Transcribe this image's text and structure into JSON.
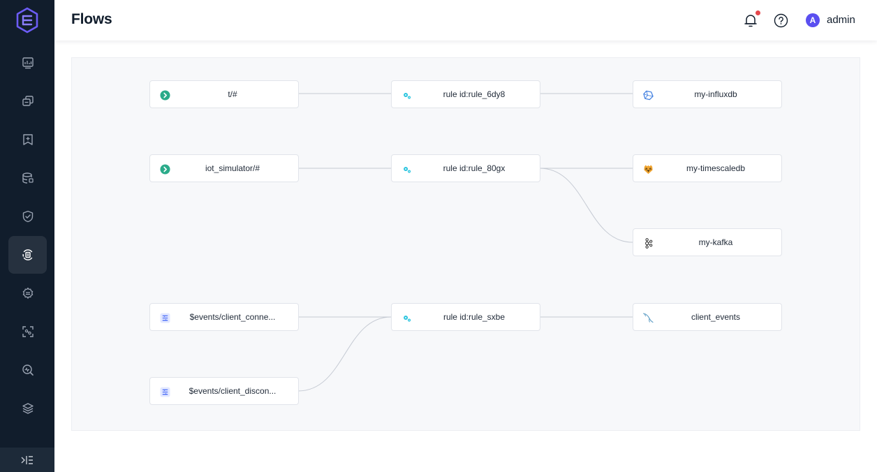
{
  "header": {
    "title": "Flows",
    "avatar_initial": "A",
    "username": "admin"
  },
  "sidebar": {
    "items": [
      {
        "icon": "dashboard-icon"
      },
      {
        "icon": "connections-icon"
      },
      {
        "icon": "subscriptions-icon"
      },
      {
        "icon": "retained-icon"
      },
      {
        "icon": "security-icon"
      },
      {
        "icon": "integration-icon",
        "active": true
      },
      {
        "icon": "settings-icon"
      },
      {
        "icon": "diagnose-icon"
      },
      {
        "icon": "monitor-icon"
      },
      {
        "icon": "plugins-icon"
      }
    ]
  },
  "flows": {
    "sources": [
      {
        "label": "t/#",
        "icon": "topic-icon"
      },
      {
        "label": "iot_simulator/#",
        "icon": "topic-icon"
      },
      {
        "label": "$events/client_conne...",
        "icon": "event-icon"
      },
      {
        "label": "$events/client_discon...",
        "icon": "event-icon"
      }
    ],
    "rules": [
      {
        "label": "rule id:rule_6dy8"
      },
      {
        "label": "rule id:rule_80gx"
      },
      {
        "label": "rule id:rule_sxbe"
      }
    ],
    "sinks": [
      {
        "label": "my-influxdb",
        "icon": "influxdb-icon"
      },
      {
        "label": "my-timescaledb",
        "icon": "timescaledb-icon"
      },
      {
        "label": "my-kafka",
        "icon": "kafka-icon"
      },
      {
        "label": "client_events",
        "icon": "mysql-icon"
      }
    ]
  },
  "colors": {
    "sidebar_bg": "#111d2c",
    "accent": "#5a4ff0",
    "topic_green": "#2bab8a",
    "rule_cyan": "#2bc5df",
    "notification_red": "#e5484d"
  }
}
